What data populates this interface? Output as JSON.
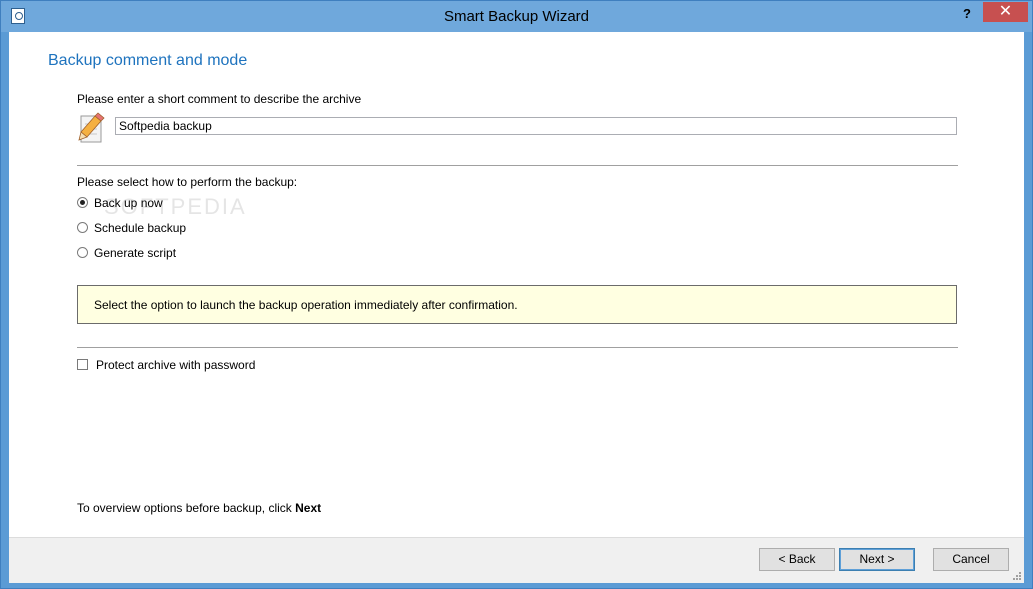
{
  "window": {
    "title": "Smart Backup Wizard",
    "help_label": "?",
    "close_label": "✕"
  },
  "page": {
    "heading": "Backup comment and mode",
    "comment_prompt": "Please enter a short comment to describe the archive",
    "comment_value": "Softpedia backup",
    "mode_prompt": "Please select how to perform the backup:",
    "modes": [
      {
        "label": "Back up now",
        "selected": true
      },
      {
        "label": "Schedule backup",
        "selected": false
      },
      {
        "label": "Generate script",
        "selected": false
      }
    ],
    "info_text": "Select the option to launch the backup operation immediately after confirmation.",
    "password_label": "Protect archive with password",
    "password_checked": false,
    "footer_prefix": "To overview options before backup, click",
    "footer_bold": "Next",
    "watermark": "SOFTPEDIA"
  },
  "buttons": {
    "back": "< Back",
    "next": "Next >",
    "cancel": "Cancel"
  },
  "colors": {
    "window_frame": "#6fa8dc",
    "heading": "#1e73be",
    "info_background": "#ffffe1",
    "close_button": "#c75050"
  }
}
